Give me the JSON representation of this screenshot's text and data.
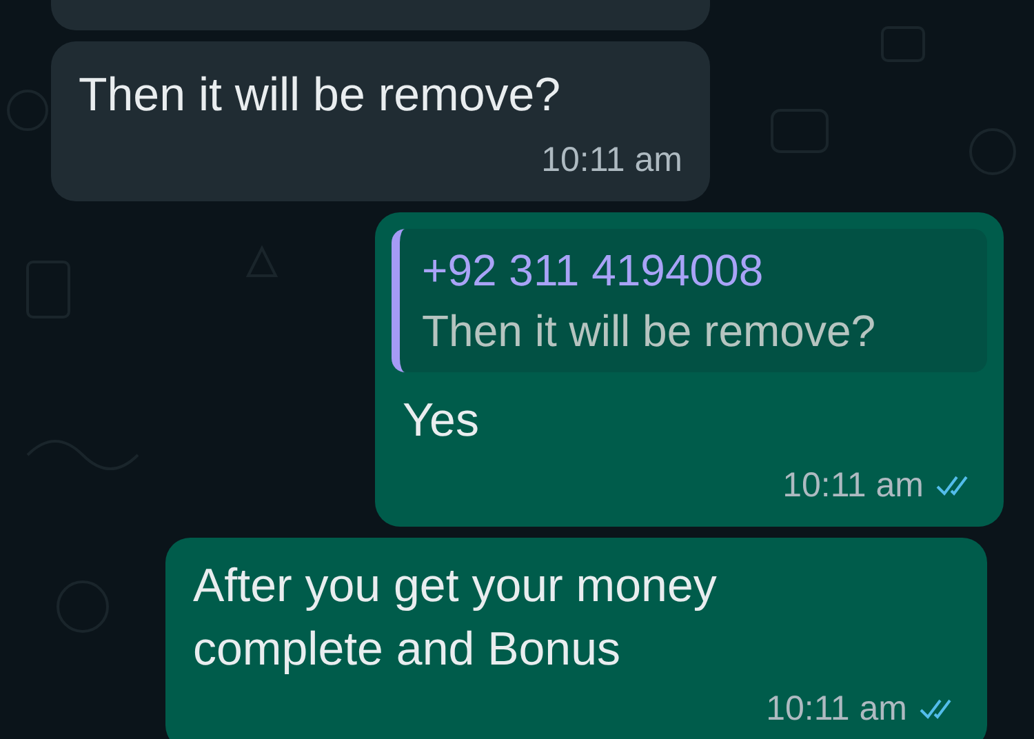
{
  "messages": [
    {
      "kind": "incoming"
    },
    {
      "kind": "incoming",
      "text": "Then it will be remove?",
      "time": "10:11 am"
    },
    {
      "kind": "outgoing",
      "quote": {
        "author": "+92 311 4194008",
        "text": "Then it will be remove?"
      },
      "text": "Yes",
      "time": "10:11 am",
      "read": true
    },
    {
      "kind": "outgoing",
      "text": "After you get your money complete and Bonus",
      "time": "10:11 am",
      "read": true
    }
  ]
}
